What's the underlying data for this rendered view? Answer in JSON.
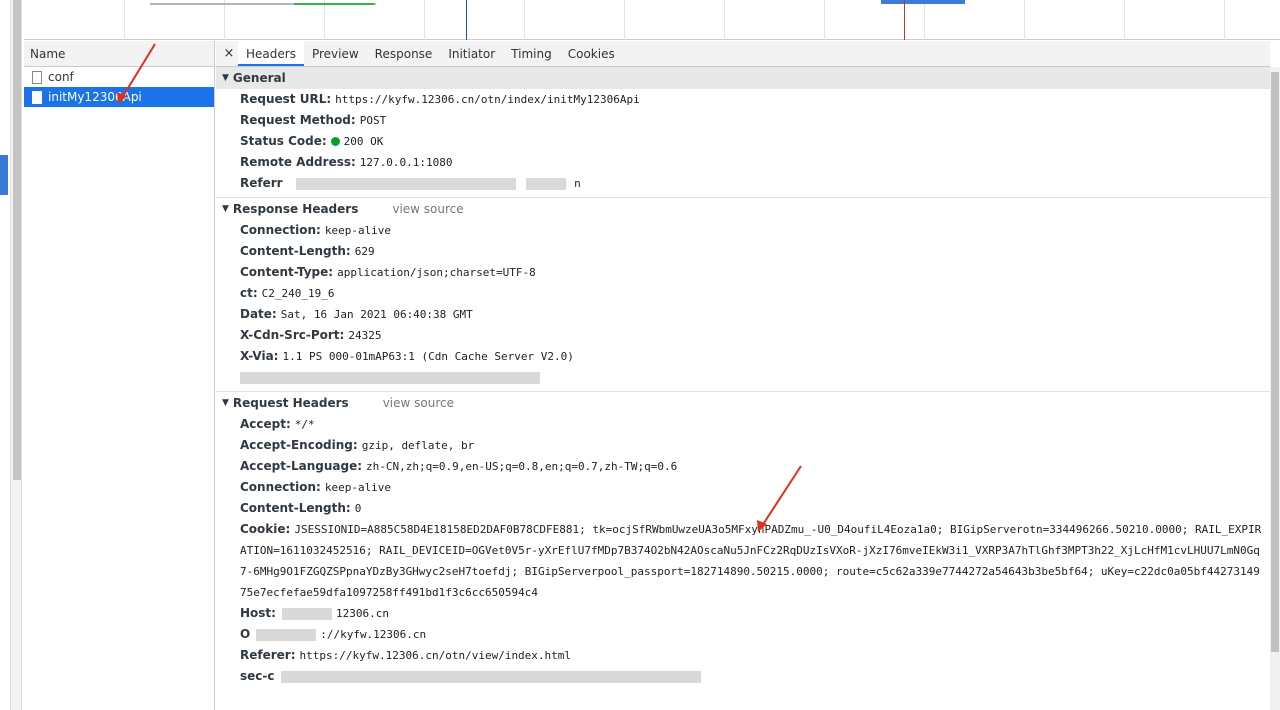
{
  "name_pane": {
    "header": "Name",
    "requests": [
      {
        "label": "conf",
        "selected": false
      },
      {
        "label": "initMy12306Api",
        "selected": true
      }
    ]
  },
  "tabs": {
    "close_glyph": "×",
    "items": [
      "Headers",
      "Preview",
      "Response",
      "Initiator",
      "Timing",
      "Cookies"
    ],
    "active": "Headers"
  },
  "general": {
    "title": "General",
    "rows": [
      {
        "key": "Request URL:",
        "value": "https://kyfw.12306.cn/otn/index/initMy12306Api"
      },
      {
        "key": "Request Method:",
        "value": "POST"
      },
      {
        "key": "Status Code:",
        "value": "200 OK"
      },
      {
        "key": "Remote Address:",
        "value": "127.0.0.1:1080"
      },
      {
        "key": "Referr",
        "value": "n"
      }
    ]
  },
  "response_headers": {
    "title": "Response Headers",
    "view_source": "view source",
    "rows": [
      {
        "key": "Connection:",
        "value": "keep-alive"
      },
      {
        "key": "Content-Length:",
        "value": "629"
      },
      {
        "key": "Content-Type:",
        "value": "application/json;charset=UTF-8"
      },
      {
        "key": "ct:",
        "value": "C2_240_19_6"
      },
      {
        "key": "Date:",
        "value": "Sat, 16 Jan 2021 06:40:38 GMT"
      },
      {
        "key": "X-Cdn-Src-Port:",
        "value": "24325"
      },
      {
        "key": "X-Via:",
        "value": "1.1 PS 000-01mAP63:1 (Cdn Cache Server V2.0)"
      }
    ]
  },
  "request_headers": {
    "title": "Request Headers",
    "view_source": "view source",
    "rows": [
      {
        "key": "Accept:",
        "value": "*/*"
      },
      {
        "key": "Accept-Encoding:",
        "value": "gzip, deflate, br"
      },
      {
        "key": "Accept-Language:",
        "value": "zh-CN,zh;q=0.9,en-US;q=0.8,en;q=0.7,zh-TW;q=0.6"
      },
      {
        "key": "Connection:",
        "value": "keep-alive"
      },
      {
        "key": "Content-Length:",
        "value": "0"
      },
      {
        "key": "Cookie:",
        "value": "JSESSIONID=A885C58D4E18158ED2DAF0B78CDFE881; tk=ocjSfRWbmUwzeUA3o5MFxynPADZmu_-U0_D4oufiL4Eoza1a0; BIGipServerotn=334496266.50210.0000; RAIL_EXPIRATION=1611032452516; RAIL_DEVICEID=OGVet0V5r-yXrEflU7fMDp7B374O2bN42AOscaNu5JnFCz2RqDUzIsVXoR-jXzI76mveIEkW3i1_VXRP3A7hTlGhf3MPT3h22_XjLcHfM1cvLHUU7LmN0Gq7-6MHg9O1FZGQZSPpnaYDzBy3GHwyc2seH7toefdj; BIGipServerpool_passport=182714890.50215.0000; route=c5c62a339e7744272a54643b3be5bf64; uKey=c22dc0a05bf4427314975e7ecfefae59dfa1097258ff491bd1f3c6cc650594c4"
      },
      {
        "key": "Host:",
        "value": "12306.cn"
      },
      {
        "key": "O",
        "value": "://kyfw.12306.cn"
      },
      {
        "key": "Referer:",
        "value": "https://kyfw.12306.cn/otn/view/index.html"
      },
      {
        "key": "sec-c",
        "value": ""
      }
    ]
  },
  "colors": {
    "accent": "#1a73e8",
    "status_ok": "#0d9f2c",
    "annotation_arrow": "#e0301e"
  }
}
